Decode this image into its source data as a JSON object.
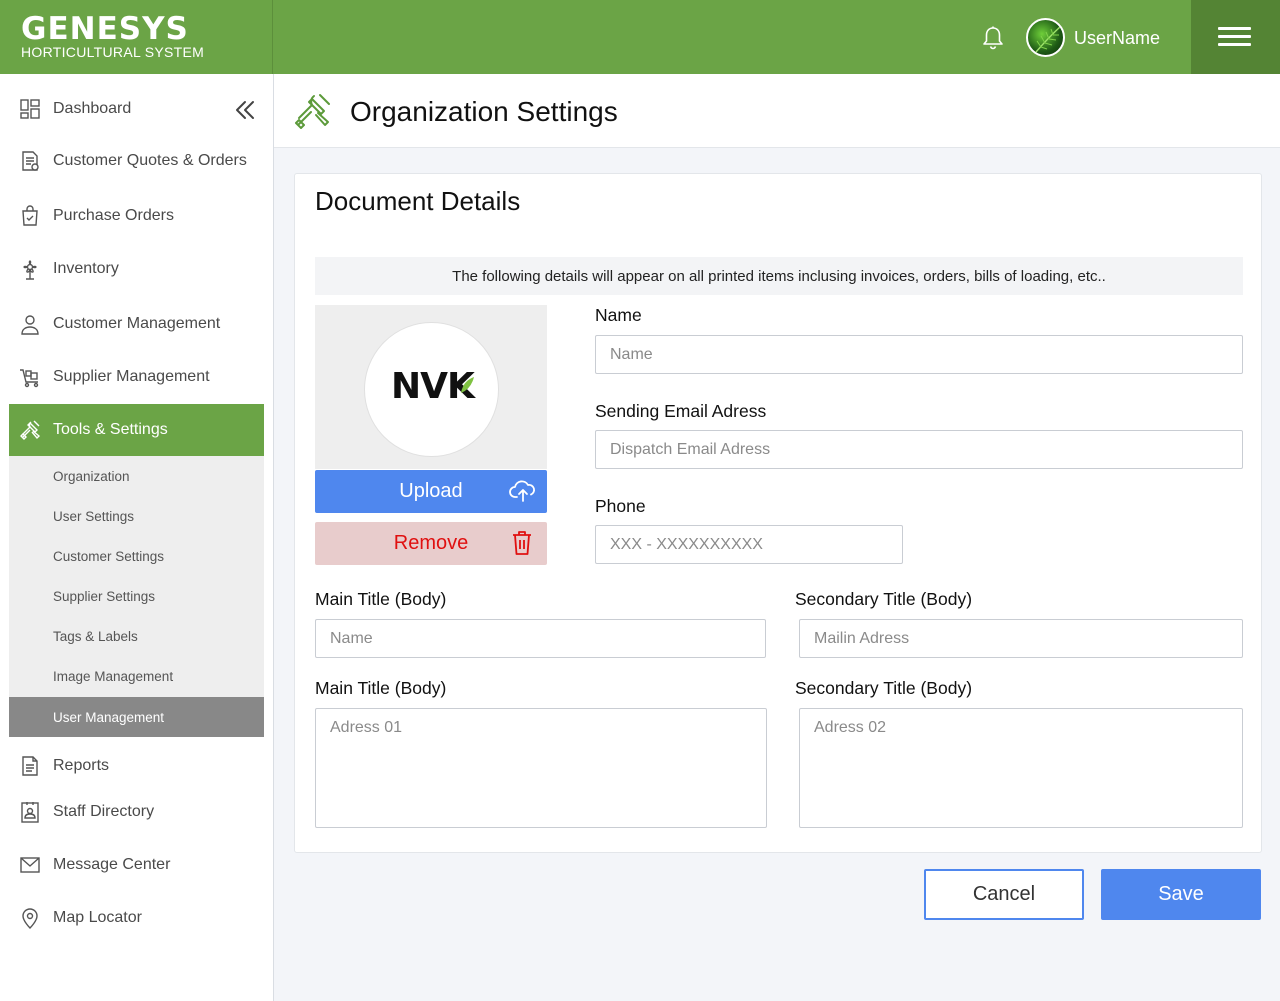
{
  "brand": {
    "name": "GENESYS",
    "subtitle": "HORTICULTURAL SYSTEM"
  },
  "header": {
    "username": "UserName",
    "notification_icon": "bell-icon",
    "menu_icon": "hamburger-icon"
  },
  "sidebar": {
    "items": [
      {
        "label": "Dashboard",
        "icon": "dashboard-icon"
      },
      {
        "label": "Customer Quotes & Orders",
        "icon": "document-icon"
      },
      {
        "label": "Purchase Orders",
        "icon": "shopping-bag-icon"
      },
      {
        "label": "Inventory",
        "icon": "plant-icon"
      },
      {
        "label": "Customer Management",
        "icon": "user-icon"
      },
      {
        "label": "Supplier Management",
        "icon": "cart-icon"
      },
      {
        "label": "Tools & Settings",
        "icon": "tools-icon",
        "active": true
      },
      {
        "label": "Reports",
        "icon": "report-icon"
      },
      {
        "label": "Staff Directory",
        "icon": "directory-icon"
      },
      {
        "label": "Message Center",
        "icon": "mail-icon"
      },
      {
        "label": "Map Locator",
        "icon": "map-pin-icon"
      }
    ],
    "subitems": [
      {
        "label": "Organization"
      },
      {
        "label": "User Settings"
      },
      {
        "label": "Customer Settings"
      },
      {
        "label": "Supplier Settings"
      },
      {
        "label": "Tags & Labels"
      },
      {
        "label": "Image Management"
      },
      {
        "label": "User Management",
        "active": true
      }
    ]
  },
  "page": {
    "title": "Organization Settings"
  },
  "card": {
    "title": "Document Details",
    "notice": "The following details will appear on all printed items inclusing invoices, orders, bills of loading, etc..",
    "logo_text": "NVK",
    "upload_label": "Upload",
    "remove_label": "Remove"
  },
  "form": {
    "name_label": "Name",
    "name_placeholder": "Name",
    "email_label": "Sending Email Adress",
    "email_placeholder": "Dispatch Email Adress",
    "phone_label": "Phone",
    "phone_placeholder": "XXX - XXXXXXXXXX",
    "main_title_label": "Main Title (Body)",
    "main_title_placeholder": "Name",
    "secondary_title_label": "Secondary Title (Body)",
    "secondary_title_placeholder": "Mailin Adress",
    "main_title_label_2": "Main Title (Body)",
    "address1_placeholder": "Adress 01",
    "secondary_title_label_2": "Secondary Title (Body)",
    "address2_placeholder": "Adress 02"
  },
  "actions": {
    "cancel_label": "Cancel",
    "save_label": "Save"
  },
  "colors": {
    "brand_green": "#6ba446",
    "brand_green_dark": "#548434",
    "primary_blue": "#4f87ee",
    "danger_red": "#e01010",
    "danger_bg": "#e8cccc"
  }
}
